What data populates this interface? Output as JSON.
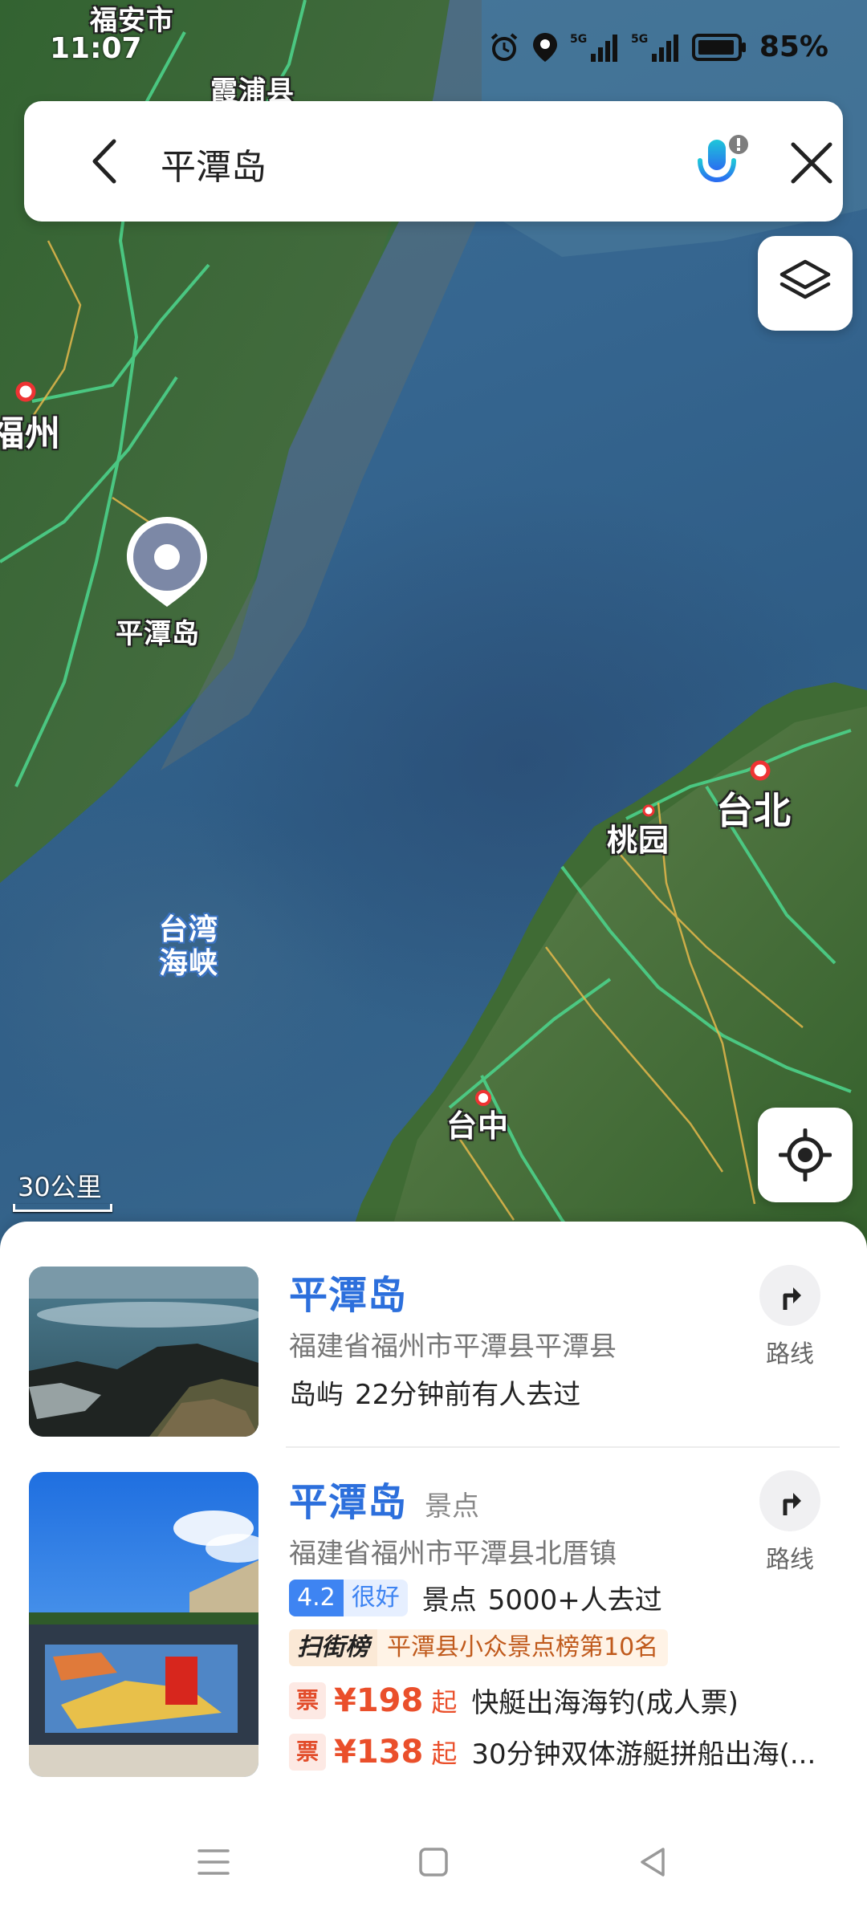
{
  "status_bar": {
    "time": "11:07",
    "network_1": "5G",
    "network_2": "5G",
    "battery_percent": "85%"
  },
  "search": {
    "query": "平潭岛"
  },
  "map": {
    "labels": {
      "fuan": "福安市",
      "xiapu": "霞浦县",
      "fuzhou": "福州",
      "marker": "平潭岛",
      "strait": "台湾海峡",
      "taoyuan": "桃园",
      "taipei": "台北",
      "taichung": "台中"
    },
    "scale": "30公里"
  },
  "results": [
    {
      "title": "平潭岛",
      "address": "福建省福州市平潭县平潭县",
      "type": "岛屿",
      "visits": "22分钟前有人去过",
      "route_label": "路线"
    },
    {
      "title": "平潭岛",
      "category": "景点",
      "address": "福建省福州市平潭县北厝镇",
      "rating_score": "4.2",
      "rating_text": "很好",
      "type": "景点",
      "visits": "5000+人去过",
      "rank_tag": "扫街榜",
      "rank_text": "平潭县小众景点榜第10名",
      "route_label": "路线",
      "deals": [
        {
          "tag": "票",
          "price": "¥198",
          "suffix": "起",
          "desc": "快艇出海海钓(成人票)"
        },
        {
          "tag": "票",
          "price": "¥138",
          "suffix": "起",
          "desc": "30分钟双体游艇拼船出海(..."
        }
      ]
    }
  ]
}
